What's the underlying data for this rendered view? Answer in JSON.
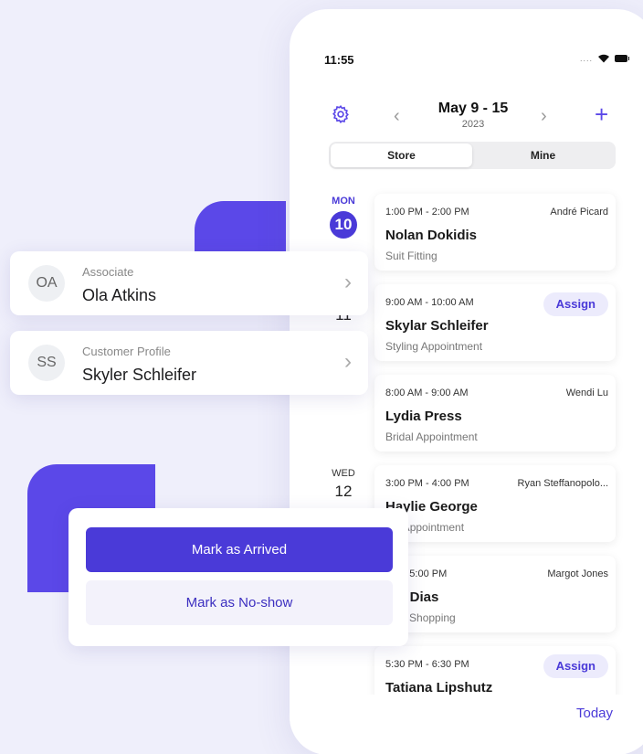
{
  "status_bar": {
    "time": "11:55",
    "signal": "....",
    "wifi_icon": "wifi-icon",
    "battery_icon": "battery-icon"
  },
  "header": {
    "date_range": "May 9 - 15",
    "year": "2023",
    "prev": "‹",
    "next": "›",
    "add": "+"
  },
  "segment": {
    "store": "Store",
    "mine": "Mine",
    "selected": "Store"
  },
  "days": {
    "mon": {
      "weekday": "MON",
      "date": "10"
    },
    "tue": {
      "date": "11"
    },
    "wed": {
      "weekday": "WED",
      "date": "12"
    }
  },
  "appointments": [
    {
      "time": "1:00 PM - 2:00 PM",
      "staff": "André Picard",
      "name": "Nolan Dokidis",
      "type": "Suit Fitting"
    },
    {
      "time": "9:00 AM - 10:00 AM",
      "assign": "Assign",
      "name": "Skylar Schleifer",
      "type": "Styling Appointment"
    },
    {
      "time": "8:00 AM - 9:00 AM",
      "staff": "Wendi Lu",
      "name": "Lydia Press",
      "type": "Bridal Appointment"
    },
    {
      "time": "3:00 PM - 4:00 PM",
      "staff": "Ryan Steffanopolo...",
      "name": "Haylie George",
      "type": "ing Appointment"
    },
    {
      "time": "PM - 5:00 PM",
      "staff": "Margot Jones",
      "name": "lon Dias",
      "type": "onal Shopping"
    },
    {
      "time": "5:30 PM - 6:30 PM",
      "assign": "Assign",
      "name": "Tatiana Lipshutz",
      "type": ""
    }
  ],
  "footer": {
    "today": "Today"
  },
  "associate_card": {
    "initials": "OA",
    "label": "Associate",
    "value": "Ola Atkins"
  },
  "customer_card": {
    "initials": "SS",
    "label": "Customer Profile",
    "value": "Skyler Schleifer"
  },
  "actions": {
    "arrived": "Mark as Arrived",
    "no_show": "Mark as No-show"
  },
  "colors": {
    "accent": "#4a3ad8",
    "deco": "#5b48e8",
    "background": "#efeffb"
  }
}
